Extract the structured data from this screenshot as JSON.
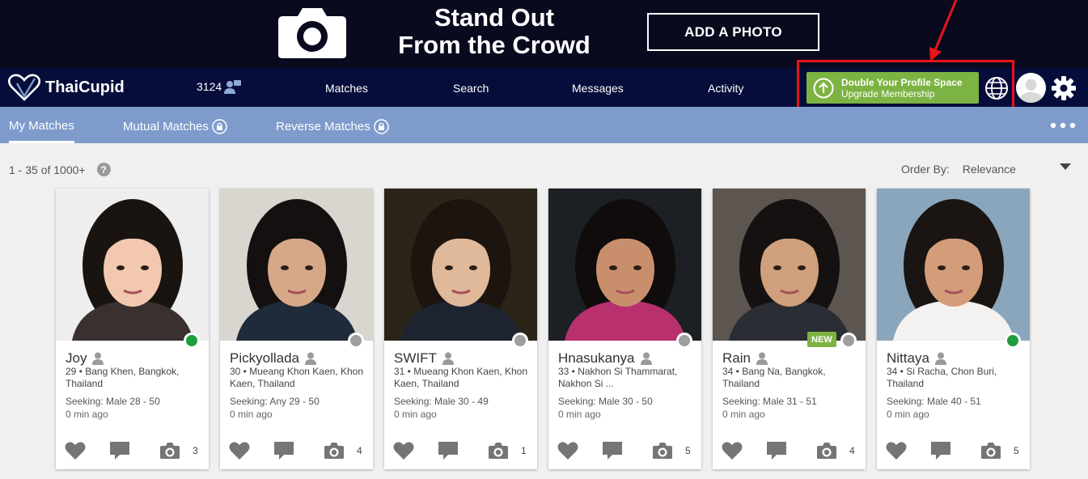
{
  "banner": {
    "headline_line1": "Stand Out",
    "headline_line2": "From the Crowd",
    "add_photo_label": "ADD A PHOTO"
  },
  "navbar": {
    "logo_text": "ThaiCupid",
    "notification_count": "3124",
    "links": [
      "Matches",
      "Search",
      "Messages",
      "Activity"
    ],
    "upgrade_title": "Double Your Profile Space",
    "upgrade_subtitle": "Upgrade Membership"
  },
  "subnav": {
    "tabs": [
      "My Matches",
      "Mutual Matches",
      "Reverse Matches"
    ]
  },
  "results": {
    "count_text": "1 - 35 of 1000+",
    "help_glyph": "?",
    "order_label": "Order By:",
    "order_value": "Relevance"
  },
  "colors": {
    "online": "#1f9d3e",
    "offline": "#9e9e9e",
    "upgrade_green": "#7cb342",
    "navbar": "#070d3a",
    "subnav": "#7e9bcb"
  },
  "cards": [
    {
      "name": "Joy",
      "location": "29 • Bang Khen, Bangkok, Thailand",
      "seeking": "Seeking: Male 28 - 50",
      "ago": "0 min ago",
      "photos": "3",
      "online": true,
      "new": ""
    },
    {
      "name": "Pickyollada",
      "location": "30 • Mueang Khon Kaen, Khon Kaen, Thailand",
      "seeking": "Seeking: Any 29 - 50",
      "ago": "0 min ago",
      "photos": "4",
      "online": false,
      "new": ""
    },
    {
      "name": "SWIFT",
      "location": "31 • Mueang Khon Kaen, Khon Kaen, Thailand",
      "seeking": "Seeking: Male 30 - 49",
      "ago": "0 min ago",
      "photos": "1",
      "online": false,
      "new": ""
    },
    {
      "name": "Hnasukanya",
      "location": "33 • Nakhon Si Thammarat, Nakhon Si ...",
      "seeking": "Seeking: Male 30 - 50",
      "ago": "0 min ago",
      "photos": "5",
      "online": false,
      "new": ""
    },
    {
      "name": "Rain",
      "location": "34 • Bang Na, Bangkok, Thailand",
      "seeking": "Seeking: Male 31 - 51",
      "ago": "0 min ago",
      "photos": "4",
      "online": false,
      "new": "NEW"
    },
    {
      "name": "Nittaya",
      "location": "34 • Si Racha, Chon Buri, Thailand",
      "seeking": "Seeking: Male 40 - 51",
      "ago": "0 min ago",
      "photos": "5",
      "online": true,
      "new": ""
    }
  ]
}
